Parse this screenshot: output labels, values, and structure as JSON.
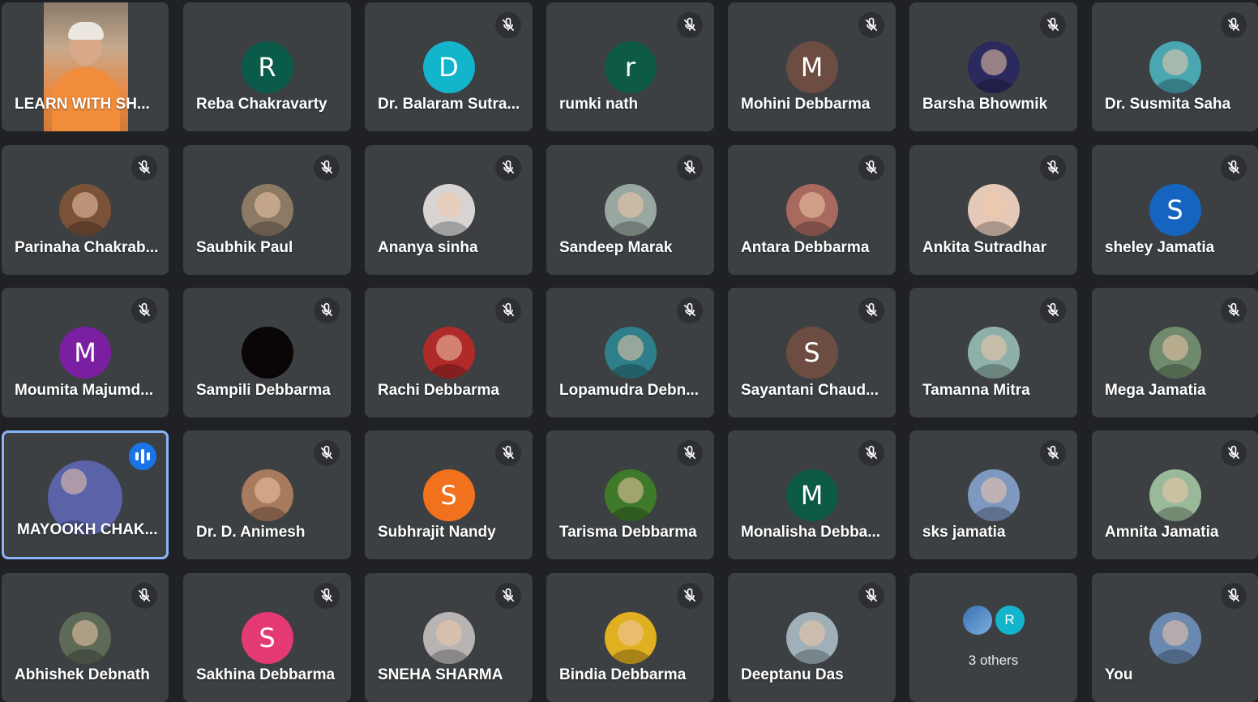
{
  "colors": {
    "tile_bg": "#3c4043",
    "page_bg": "#202124",
    "speaking_border": "#8ab4f8",
    "speaking_badge": "#1a73e8"
  },
  "participants": [
    {
      "name": "LEARN WITH SH...",
      "type": "video",
      "muted": false
    },
    {
      "name": "Reba Chakravarty",
      "type": "letter",
      "letter": "R",
      "color": "#0b5b4a",
      "muted": false
    },
    {
      "name": "Dr. Balaram Sutra...",
      "type": "letter",
      "letter": "D",
      "color": "#12b5cb",
      "muted": true
    },
    {
      "name": "rumki nath",
      "type": "letter",
      "letter": "r",
      "color": "#0d5a45",
      "muted": true
    },
    {
      "name": "Mohini Debbarma",
      "type": "letter",
      "letter": "M",
      "color": "#6d4c41",
      "muted": true
    },
    {
      "name": "Barsha Bhowmik",
      "type": "photo",
      "color": "#2b2a5e",
      "muted": true
    },
    {
      "name": "Dr. Susmita Saha",
      "type": "photo",
      "color": "#4aa6b0",
      "muted": true
    },
    {
      "name": "Parinaha Chakrab...",
      "type": "photo",
      "color": "#7a5238",
      "muted": true
    },
    {
      "name": "Saubhik Paul",
      "type": "photo",
      "color": "#8c7a64",
      "muted": true
    },
    {
      "name": "Ananya sinha",
      "type": "photo",
      "color": "#d9d4d4",
      "muted": true
    },
    {
      "name": "Sandeep Marak",
      "type": "photo",
      "color": "#9aa7a0",
      "muted": true
    },
    {
      "name": "Antara Debbarma",
      "type": "photo",
      "color": "#a86a5e",
      "muted": true
    },
    {
      "name": "Ankita Sutradhar",
      "type": "photo",
      "color": "#e4c8b8",
      "muted": true
    },
    {
      "name": "sheley Jamatia",
      "type": "letter",
      "letter": "S",
      "color": "#1565c0",
      "muted": true
    },
    {
      "name": "Moumita Majumd...",
      "type": "letter",
      "letter": "M",
      "color": "#7b1fa2",
      "muted": true
    },
    {
      "name": "Sampili Debbarma",
      "type": "dark",
      "color": "#0a0606",
      "muted": true
    },
    {
      "name": "Rachi Debbarma",
      "type": "photo",
      "color": "#b02a2a",
      "muted": true
    },
    {
      "name": "Lopamudra Debn...",
      "type": "photo",
      "color": "#2e7f8a",
      "muted": true
    },
    {
      "name": "Sayantani Chaud...",
      "type": "letter",
      "letter": "S",
      "color": "#6d4c41",
      "muted": true
    },
    {
      "name": "Tamanna Mitra",
      "type": "photo",
      "color": "#8fb0a8",
      "muted": true
    },
    {
      "name": "Mega Jamatia",
      "type": "photo",
      "color": "#6f8a6c",
      "muted": true
    },
    {
      "name": "MAYOOKH CHAK...",
      "type": "photo",
      "color": "#5a63a8",
      "big": true,
      "speaking": true,
      "muted": false
    },
    {
      "name": "Dr. D. Animesh",
      "type": "photo",
      "color": "#a87a5e",
      "muted": true
    },
    {
      "name": "Subhrajit Nandy",
      "type": "letter",
      "letter": "S",
      "color": "#f2711c",
      "muted": true
    },
    {
      "name": "Tarisma Debbarma",
      "type": "photo",
      "color": "#3f7a2a",
      "muted": true
    },
    {
      "name": "Monalisha Debba...",
      "type": "letter",
      "letter": "M",
      "color": "#0d5a45",
      "muted": true
    },
    {
      "name": "sks jamatia",
      "type": "photo",
      "color": "#7e98c0",
      "muted": true
    },
    {
      "name": "Amnita Jamatia",
      "type": "photo",
      "color": "#9ab89a",
      "muted": true
    },
    {
      "name": "Abhishek Debnath",
      "type": "photo",
      "color": "#5e6a58",
      "muted": true
    },
    {
      "name": "Sakhina Debbarma",
      "type": "letter",
      "letter": "S",
      "color": "#e53974",
      "muted": true
    },
    {
      "name": "SNEHA SHARMA",
      "type": "photo",
      "color": "#b8b4b4",
      "muted": true
    },
    {
      "name": "Bindia Debbarma",
      "type": "photo",
      "color": "#e0b020",
      "muted": true
    },
    {
      "name": "Deeptanu Das",
      "type": "photo",
      "color": "#9fb0b8",
      "muted": true
    },
    {
      "name": "3 others",
      "type": "others",
      "second_letter": "R",
      "muted": false
    },
    {
      "name": "You",
      "type": "photo",
      "color": "#6a88b0",
      "muted": true
    }
  ]
}
